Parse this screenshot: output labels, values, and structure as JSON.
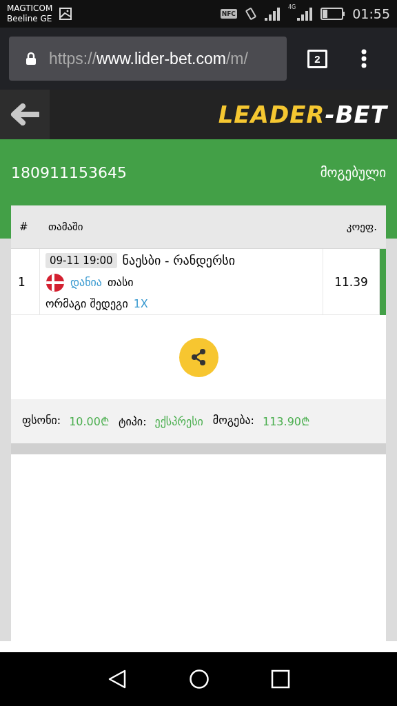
{
  "status_bar": {
    "carrier": "MAGTICOM",
    "network": "Beeline GE",
    "time": "01:55",
    "nfc": "NFC",
    "net_type": "4G"
  },
  "browser": {
    "url_scheme": "https://",
    "url_host": "www.lider-bet.com",
    "url_rest": "/m/",
    "tab_count": "2"
  },
  "header": {
    "logo_main": "LEADER",
    "logo_tail": "-BET"
  },
  "ticket": {
    "id": "180911153645",
    "status": "მოგებული"
  },
  "table": {
    "columns": [
      "#",
      "თამაში",
      "კოეფ."
    ],
    "rows": [
      {
        "number": "1",
        "datetime": "09-11 19:00",
        "match": "ნაესბი - რანდერსი",
        "country": "დანია",
        "tournament": "თასი",
        "market": "ორმაგი შედეგი",
        "pick": "1X",
        "odds": "11.39",
        "color": "#43a047"
      }
    ]
  },
  "summary": [
    {
      "label": "ფსონი:",
      "value": "10.00₾"
    },
    {
      "label": "ტიპი:",
      "value": "ექსპრესი"
    },
    {
      "label": "მოგება:",
      "value": "113.90₾"
    }
  ]
}
